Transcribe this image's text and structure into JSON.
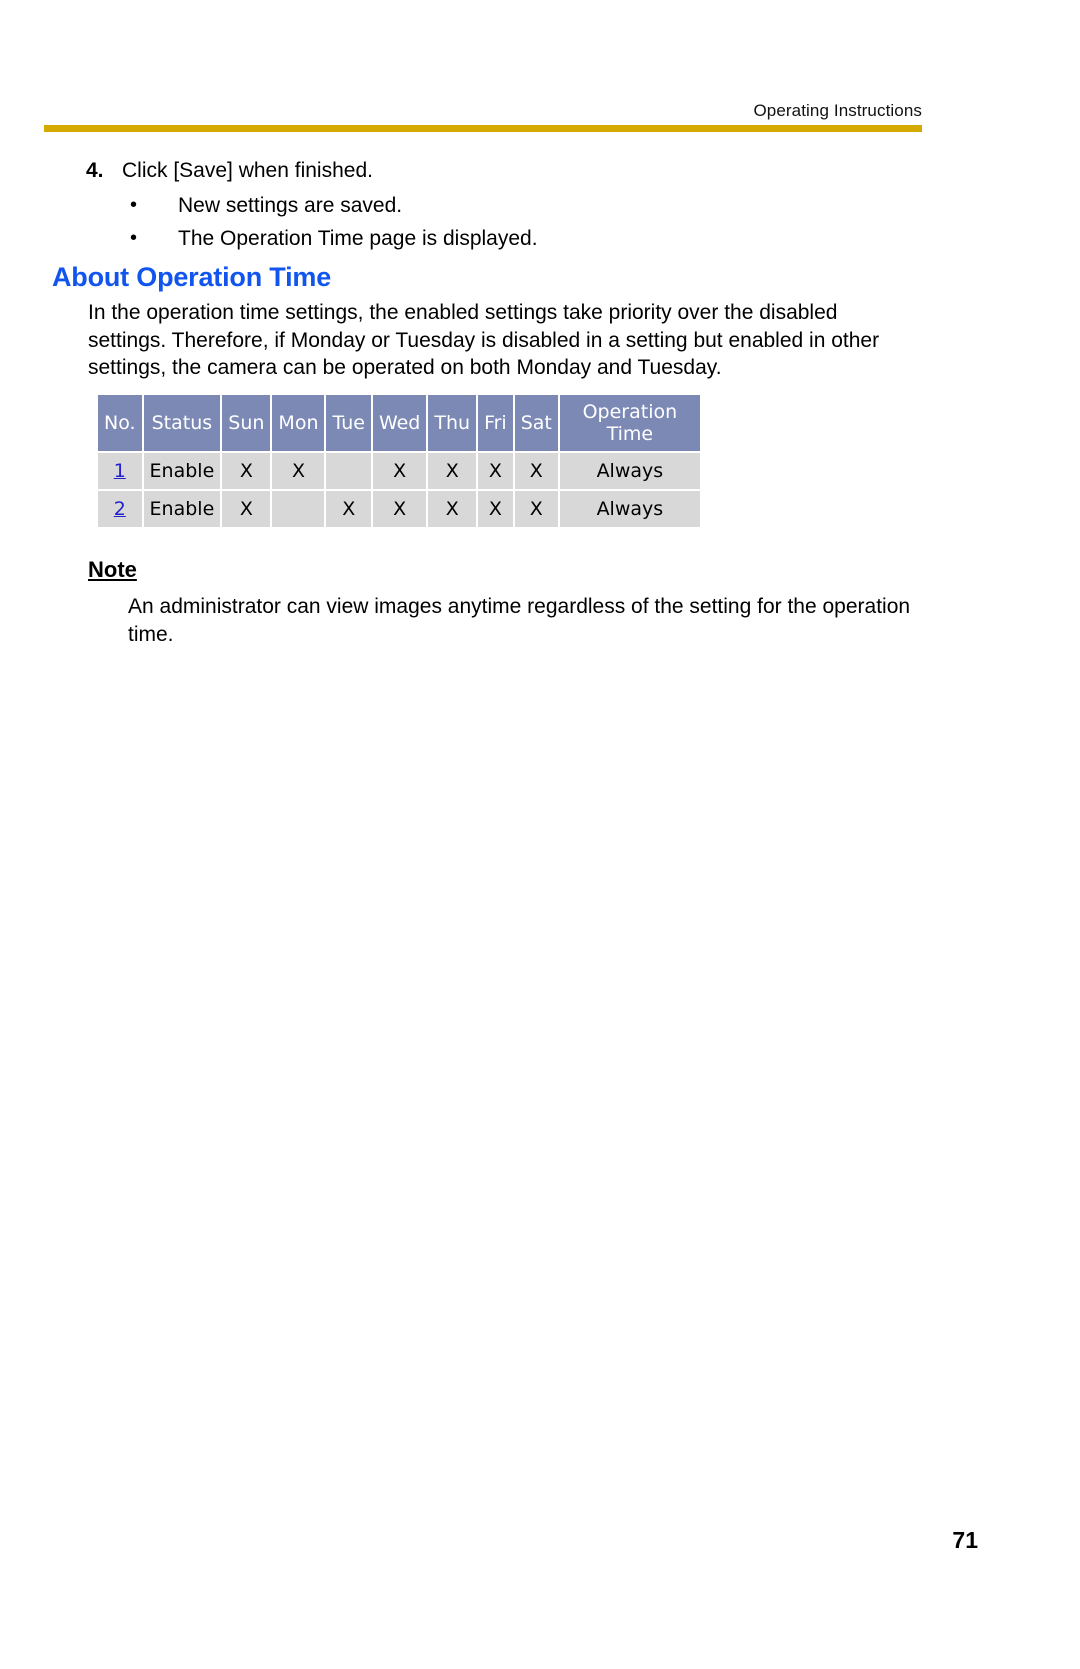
{
  "header": {
    "running_head": "Operating Instructions",
    "rule_color": "#d4aa00"
  },
  "step": {
    "number": "4.",
    "text": "Click [Save] when finished.",
    "bullet_glyph": "•",
    "bullets": [
      "New settings are saved.",
      "The Operation Time page is displayed."
    ]
  },
  "section": {
    "heading": "About Operation Time",
    "heading_color": "#1155ee",
    "paragraph": "In the operation time settings, the enabled settings take priority over the disabled settings. Therefore, if Monday or Tuesday is disabled in a setting but enabled in other settings, the camera can be operated on both Monday and Tuesday."
  },
  "op_table": {
    "header_bg": "#7b89b4",
    "cell_bg": "#d8d8d8",
    "link_color": "#2222cc",
    "columns": [
      "No.",
      "Status",
      "Sun",
      "Mon",
      "Tue",
      "Wed",
      "Thu",
      "Fri",
      "Sat",
      "Operation Time"
    ],
    "mark": "X",
    "rows": [
      {
        "no": "1",
        "status": "Enable",
        "sun": "X",
        "mon": "X",
        "tue": "",
        "wed": "X",
        "thu": "X",
        "fri": "X",
        "sat": "X",
        "operation_time": "Always"
      },
      {
        "no": "2",
        "status": "Enable",
        "sun": "X",
        "mon": "",
        "tue": "X",
        "wed": "X",
        "thu": "X",
        "fri": "X",
        "sat": "X",
        "operation_time": "Always"
      }
    ]
  },
  "note": {
    "title": "Note",
    "body": "An administrator can view images anytime regardless of the setting for the operation time."
  },
  "footer": {
    "page_number": "71"
  }
}
